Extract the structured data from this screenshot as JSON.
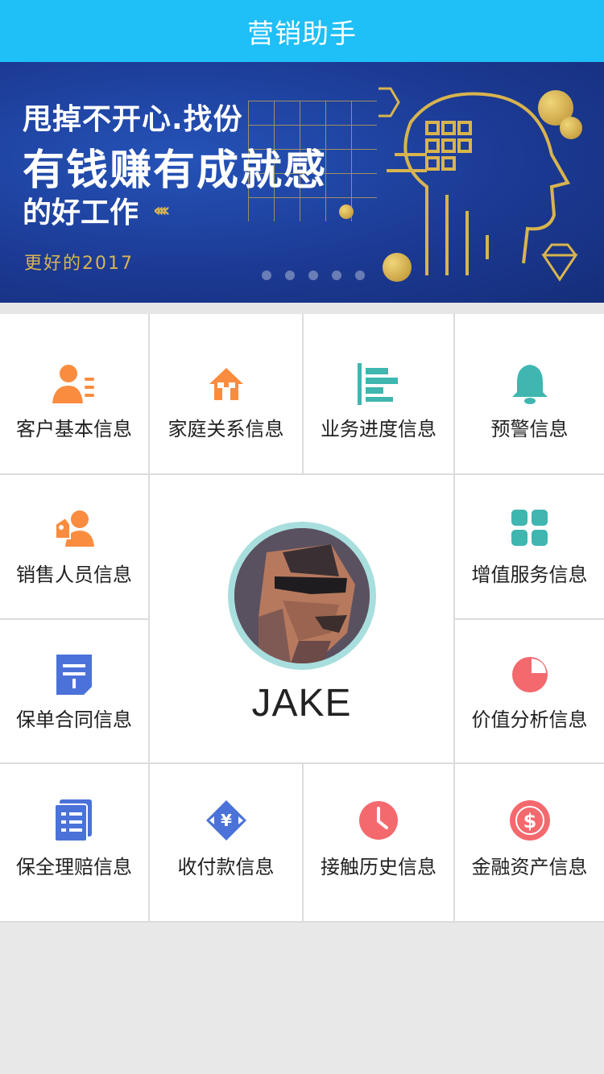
{
  "header": {
    "title": "营销助手"
  },
  "banner": {
    "line1": "甩掉不开心.找份",
    "line2": "有钱赚有成就感",
    "line3": "的好工作",
    "line4": "更好的2017",
    "dots_count": 5
  },
  "menu": {
    "customer_basic": "客户基本信息",
    "family_relation": "家庭关系信息",
    "business_progress": "业务进度信息",
    "warning": "预警信息",
    "sales_staff": "销售人员信息",
    "value_added": "增值服务信息",
    "policy_contract": "保单合同信息",
    "value_analysis": "价值分析信息",
    "claims": "保全理赔信息",
    "payments": "收付款信息",
    "contact_history": "接触历史信息",
    "financial_assets": "金融资产信息"
  },
  "user": {
    "name": "JAKE"
  },
  "colors": {
    "header": "#1fbff7",
    "orange": "#f98c3f",
    "teal": "#3fb6b0",
    "blue": "#4b72d9",
    "red": "#f4696e"
  }
}
